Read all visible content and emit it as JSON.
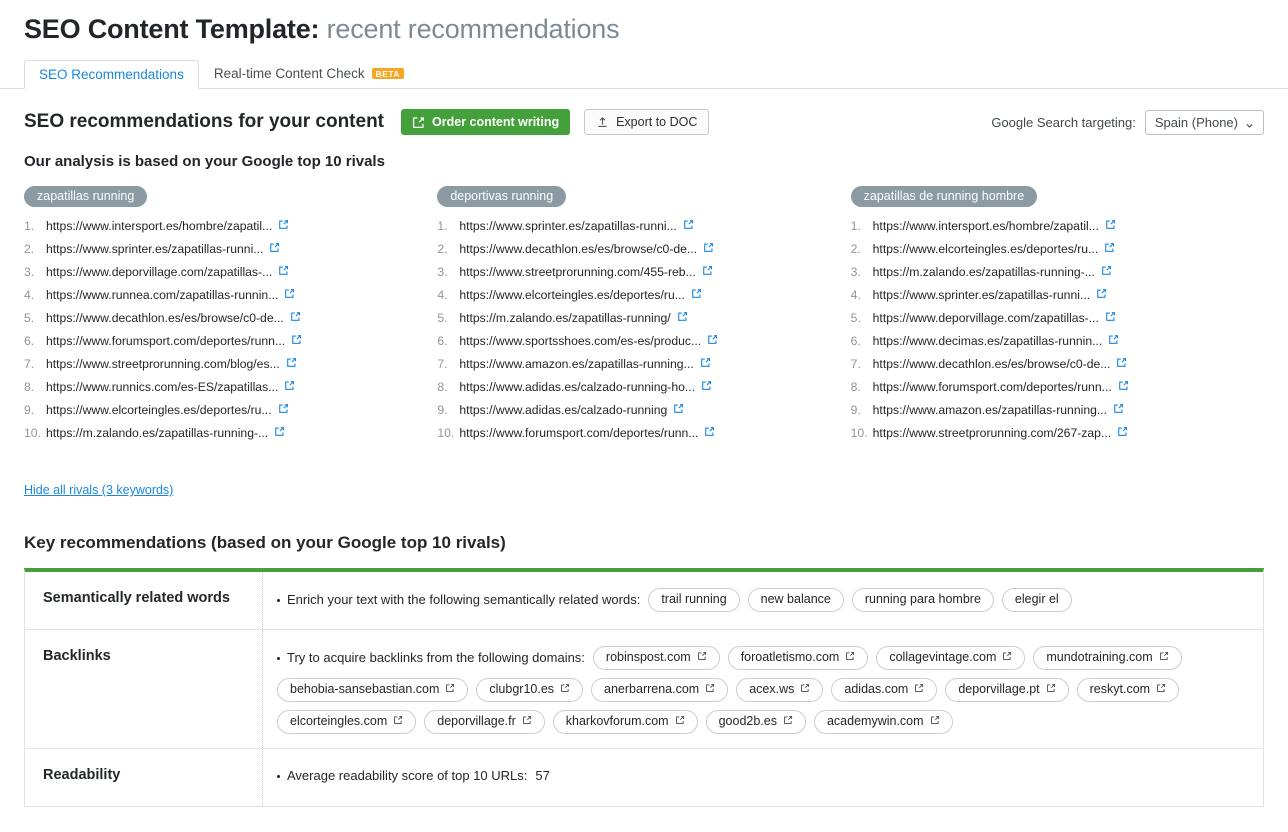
{
  "header": {
    "title_prefix": "SEO Content Template:",
    "title_subject": "recent recommendations"
  },
  "tabs": [
    {
      "label": "SEO Recommendations",
      "active": true,
      "badge": ""
    },
    {
      "label": "Real-time Content Check",
      "active": false,
      "badge": "BETA"
    }
  ],
  "toolbar": {
    "section_title": "SEO recommendations for your content",
    "order_button": "Order content writing",
    "export_button": "Export to DOC",
    "targeting_label": "Google Search targeting:",
    "targeting_value": "Spain (Phone)"
  },
  "analysis_subhead": "Our analysis is based on your Google top 10 rivals",
  "hide_rivals_link": "Hide all rivals (3 keywords)",
  "key_recommendations_title": "Key recommendations (based on your Google top 10 rivals)",
  "rivals": [
    {
      "keyword": "zapatillas running",
      "urls": [
        "https://www.intersport.es/hombre/zapatil...",
        "https://www.sprinter.es/zapatillas-runni...",
        "https://www.deporvillage.com/zapatillas-...",
        "https://www.runnea.com/zapatillas-runnin...",
        "https://www.decathlon.es/es/browse/c0-de...",
        "https://www.forumsport.com/deportes/runn...",
        "https://www.streetprorunning.com/blog/es...",
        "https://www.runnics.com/es-ES/zapatillas...",
        "https://www.elcorteingles.es/deportes/ru...",
        "https://m.zalando.es/zapatillas-running-..."
      ]
    },
    {
      "keyword": "deportivas running",
      "urls": [
        "https://www.sprinter.es/zapatillas-runni...",
        "https://www.decathlon.es/es/browse/c0-de...",
        "https://www.streetprorunning.com/455-reb...",
        "https://www.elcorteingles.es/deportes/ru...",
        "https://m.zalando.es/zapatillas-running/",
        "https://www.sportsshoes.com/es-es/produc...",
        "https://www.amazon.es/zapatillas-running...",
        "https://www.adidas.es/calzado-running-ho...",
        "https://www.adidas.es/calzado-running",
        "https://www.forumsport.com/deportes/runn..."
      ]
    },
    {
      "keyword": "zapatillas de running hombre",
      "urls": [
        "https://www.intersport.es/hombre/zapatil...",
        "https://www.elcorteingles.es/deportes/ru...",
        "https://m.zalando.es/zapatillas-running-...",
        "https://www.sprinter.es/zapatillas-runni...",
        "https://www.deporvillage.com/zapatillas-...",
        "https://www.decimas.es/zapatillas-runnin...",
        "https://www.decathlon.es/es/browse/c0-de...",
        "https://www.forumsport.com/deportes/runn...",
        "https://www.amazon.es/zapatillas-running...",
        "https://www.streetprorunning.com/267-zap..."
      ]
    }
  ],
  "recommendations": [
    {
      "label": "Semantically related  words",
      "lead": "Enrich your text with the following semantically related words:",
      "chips": [
        "trail running",
        "new balance",
        "running para hombre",
        "elegir el"
      ],
      "chips_external": false,
      "plain": ""
    },
    {
      "label": "Backlinks",
      "lead": "Try to acquire backlinks from the following domains:",
      "chips": [
        "robinspost.com",
        "foroatletismo.com",
        "collagevintage.com",
        "mundotraining.com",
        "behobia-sansebastian.com",
        "clubgr10.es",
        "anerbarrena.com",
        "acex.ws",
        "adidas.com",
        "deporvillage.pt",
        "reskyt.com",
        "elcorteingles.com",
        "deporvillage.fr",
        "kharkovforum.com",
        "good2b.es",
        "academywin.com"
      ],
      "chips_external": true,
      "plain": ""
    },
    {
      "label": "Readability",
      "lead": "Average readability score of top 10 URLs:",
      "chips": [],
      "chips_external": false,
      "plain": "57"
    }
  ],
  "colors": {
    "accent_green": "#43a03a",
    "link_blue": "#1a87e0",
    "pill_gray": "#8b9aa3",
    "beta_orange": "#f5a623"
  },
  "icons": {
    "order": "pencil-square-icon",
    "export": "upload-icon",
    "caret": "chevron-down-icon",
    "external": "external-link-icon"
  }
}
